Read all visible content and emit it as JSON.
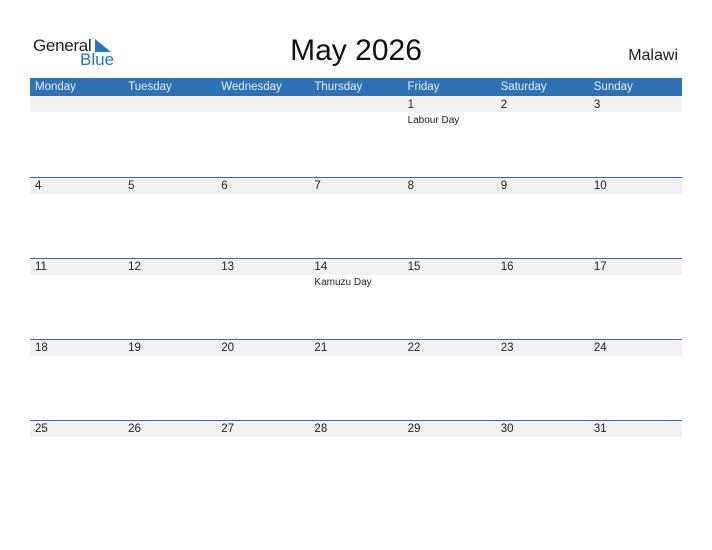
{
  "logo": {
    "general": "General",
    "blue": "Blue"
  },
  "title": "May 2026",
  "country": "Malawi",
  "weekdays": [
    "Monday",
    "Tuesday",
    "Wednesday",
    "Thursday",
    "Friday",
    "Saturday",
    "Sunday"
  ],
  "weeks": [
    [
      {
        "day": ""
      },
      {
        "day": ""
      },
      {
        "day": ""
      },
      {
        "day": ""
      },
      {
        "day": "1",
        "holiday": "Labour Day"
      },
      {
        "day": "2"
      },
      {
        "day": "3"
      }
    ],
    [
      {
        "day": "4"
      },
      {
        "day": "5"
      },
      {
        "day": "6"
      },
      {
        "day": "7"
      },
      {
        "day": "8"
      },
      {
        "day": "9"
      },
      {
        "day": "10"
      }
    ],
    [
      {
        "day": "11"
      },
      {
        "day": "12"
      },
      {
        "day": "13"
      },
      {
        "day": "14",
        "holiday": "Kamuzu Day"
      },
      {
        "day": "15"
      },
      {
        "day": "16"
      },
      {
        "day": "17"
      }
    ],
    [
      {
        "day": "18"
      },
      {
        "day": "19"
      },
      {
        "day": "20"
      },
      {
        "day": "21"
      },
      {
        "day": "22"
      },
      {
        "day": "23"
      },
      {
        "day": "24"
      }
    ],
    [
      {
        "day": "25"
      },
      {
        "day": "26"
      },
      {
        "day": "27"
      },
      {
        "day": "28"
      },
      {
        "day": "29"
      },
      {
        "day": "30"
      },
      {
        "day": "31"
      }
    ]
  ]
}
